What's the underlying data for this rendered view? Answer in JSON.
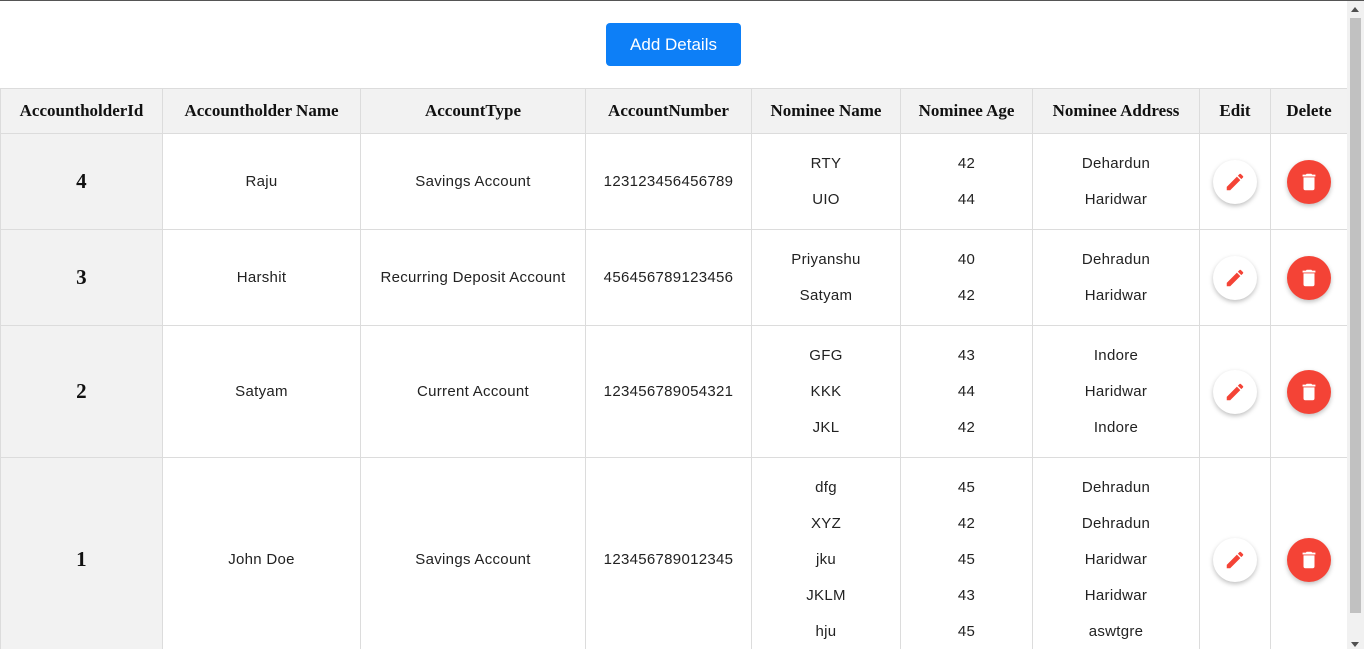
{
  "toolbar": {
    "add_label": "Add Details"
  },
  "colors": {
    "primary": "#0d7ff7",
    "danger": "#f44336",
    "header_bg": "#f2f2f2"
  },
  "icons": {
    "edit": "pencil-icon",
    "delete": "trash-icon"
  },
  "table": {
    "headers": {
      "id": "AccountholderId",
      "name": "Accountholder Name",
      "type": "AccountType",
      "number": "AccountNumber",
      "nominee_name": "Nominee Name",
      "nominee_age": "Nominee Age",
      "nominee_address": "Nominee Address",
      "edit": "Edit",
      "delete": "Delete"
    },
    "rows": [
      {
        "id": "4",
        "name": "Raju",
        "type": "Savings Account",
        "number": "123123456456789",
        "nominees": [
          {
            "name": "RTY",
            "age": "42",
            "address": "Dehardun"
          },
          {
            "name": "UIO",
            "age": "44",
            "address": "Haridwar"
          }
        ]
      },
      {
        "id": "3",
        "name": "Harshit",
        "type": "Recurring Deposit Account",
        "number": "456456789123456",
        "nominees": [
          {
            "name": "Priyanshu",
            "age": "40",
            "address": "Dehradun"
          },
          {
            "name": "Satyam",
            "age": "42",
            "address": "Haridwar"
          }
        ]
      },
      {
        "id": "2",
        "name": "Satyam",
        "type": "Current Account",
        "number": "123456789054321",
        "nominees": [
          {
            "name": "GFG",
            "age": "43",
            "address": "Indore"
          },
          {
            "name": "KKK",
            "age": "44",
            "address": "Haridwar"
          },
          {
            "name": "JKL",
            "age": "42",
            "address": "Indore"
          }
        ]
      },
      {
        "id": "1",
        "name": "John Doe",
        "type": "Savings Account",
        "number": "123456789012345",
        "nominees": [
          {
            "name": "dfg",
            "age": "45",
            "address": "Dehradun"
          },
          {
            "name": "XYZ",
            "age": "42",
            "address": "Dehradun"
          },
          {
            "name": "jku",
            "age": "45",
            "address": "Haridwar"
          },
          {
            "name": "JKLM",
            "age": "43",
            "address": "Haridwar"
          },
          {
            "name": "hju",
            "age": "45",
            "address": "aswtgre"
          }
        ]
      }
    ]
  }
}
